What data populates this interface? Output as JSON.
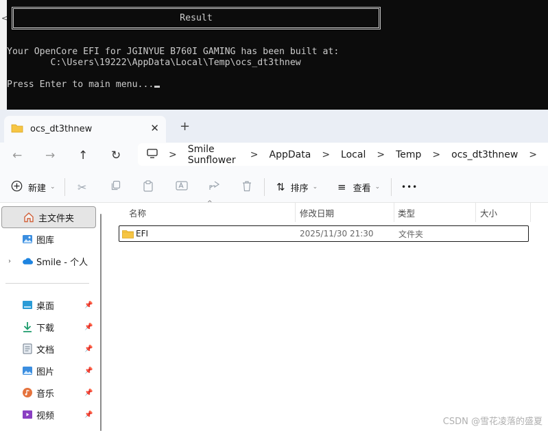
{
  "console": {
    "result_title": "Result",
    "line1": "Your OpenCore EFI for JGINYUE B760I GAMING has been built at:",
    "line2": "        C:\\Users\\19222\\AppData\\Local\\Temp\\ocs_dt3thnew",
    "line3": "Press Enter to main menu..."
  },
  "tab": {
    "title": "ocs_dt3thnew",
    "close": "✕",
    "new": "+"
  },
  "address": {
    "crumbs": [
      "Smile Sunflower",
      "AppData",
      "Local",
      "Temp",
      "ocs_dt3thnew"
    ],
    "sep": ">"
  },
  "toolbar": {
    "new_label": "新建",
    "sort_label": "排序",
    "view_label": "查看",
    "more_label": "•••"
  },
  "sidebar": {
    "items": [
      {
        "label": "主文件夹",
        "icon": "home-icon",
        "selected": true
      },
      {
        "label": "图库",
        "icon": "gallery-icon"
      },
      {
        "label": "Smile - 个人",
        "icon": "onedrive-icon"
      },
      {
        "label": "桌面",
        "icon": "desktop-icon",
        "pinned": true
      },
      {
        "label": "下载",
        "icon": "download-icon",
        "pinned": true
      },
      {
        "label": "文档",
        "icon": "document-icon",
        "pinned": true
      },
      {
        "label": "图片",
        "icon": "pictures-icon",
        "pinned": true
      },
      {
        "label": "音乐",
        "icon": "music-icon",
        "pinned": true
      },
      {
        "label": "视频",
        "icon": "video-icon",
        "pinned": true
      }
    ]
  },
  "columns": {
    "name": "名称",
    "modified": "修改日期",
    "type": "类型",
    "size": "大小"
  },
  "files": [
    {
      "name": "EFI",
      "modified": "2025/11/30 21:30",
      "type": "文件夹",
      "size": ""
    }
  ],
  "watermark": "CSDN @雪花凌落的盛夏",
  "colors": {
    "console_bg": "#0c0c0c",
    "console_text": "#cccccc",
    "folder": "#f6c544",
    "selection": "#e5e5e5"
  }
}
